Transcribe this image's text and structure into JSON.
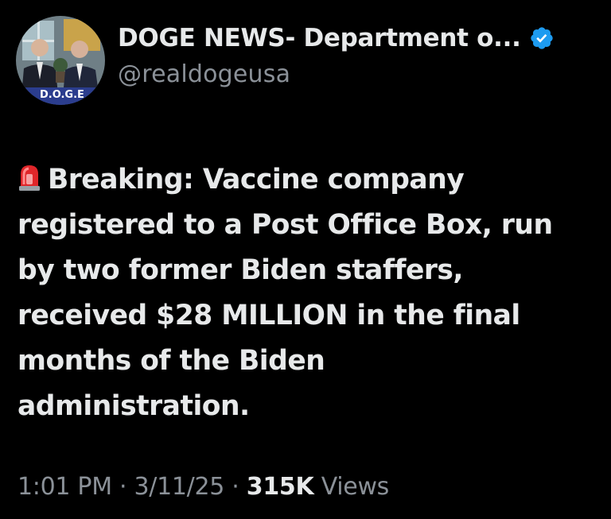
{
  "author": {
    "display_name": "DOGE NEWS- Department o...",
    "handle": "@realdogeusa",
    "verified": true,
    "verified_color": "#1d9bf0",
    "avatar_label": "D.O.G.E"
  },
  "post": {
    "emoji": "siren-icon",
    "text_lines": [
      "Breaking: Vaccine company",
      "registered to a Post Office Box, run",
      "by two former Biden staffers,",
      "received $28 MILLION in the final",
      "months of the Biden",
      "administration."
    ]
  },
  "meta": {
    "time": "1:01 PM",
    "sep1": " · ",
    "date": "3/11/25",
    "sep2": " · ",
    "views_count": "315K",
    "views_label": " Views"
  }
}
